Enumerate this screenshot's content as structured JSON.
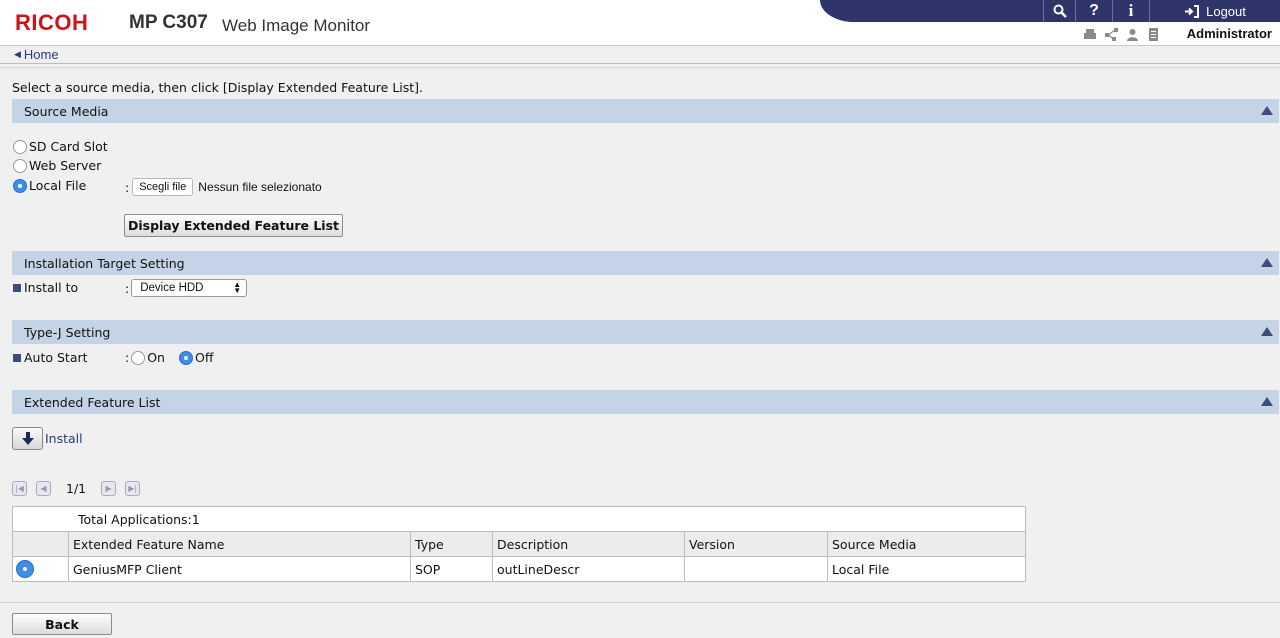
{
  "header": {
    "brand": "RICOH",
    "model": "MP C307",
    "product": "Web Image Monitor",
    "logout_label": "Logout",
    "user": "Administrator",
    "toolbar_icons": [
      "search-icon",
      "help-icon",
      "info-icon",
      "logout-icon"
    ],
    "status_icons": [
      "printer-status-icon",
      "network-icon",
      "user-icon",
      "document-icon"
    ],
    "bar_color": "#2f3569"
  },
  "breadcrumb": {
    "home": "Home"
  },
  "intro": "Select a source media, then click [Display Extended Feature List].",
  "source_media": {
    "title": "Source Media",
    "options": [
      {
        "label": "SD Card Slot",
        "selected": false
      },
      {
        "label": "Web Server",
        "selected": false
      },
      {
        "label": "Local File",
        "selected": true
      }
    ],
    "separator": ":",
    "file_button": "Scegli file",
    "file_status": "Nessun file selezionato",
    "display_button": "Display Extended Feature List"
  },
  "installation": {
    "title": "Installation Target Setting",
    "install_to_label": "Install to",
    "separator": ":",
    "install_to_value": "Device HDD"
  },
  "typej": {
    "title": "Type-J Setting",
    "auto_start_label": "Auto Start",
    "separator": ":",
    "on_label": "On",
    "off_label": "Off",
    "selected": "Off"
  },
  "feature_list": {
    "title": "Extended Feature List",
    "install_label": "Install",
    "page_indicator": "1/1",
    "total_label": "Total Applications:",
    "total_value": "1",
    "columns": [
      "Extended Feature Name",
      "Type",
      "Description",
      "Version",
      "Source Media"
    ],
    "rows": [
      {
        "name": "GeniusMFP Client",
        "type": "SOP",
        "description": "outLineDescr",
        "version": "",
        "source": "Local File",
        "selected": true
      }
    ]
  },
  "footer": {
    "back_label": "Back"
  },
  "colors": {
    "section_bar": "#c5d3e6",
    "accent": "#3b8fe8",
    "brand_red": "#d0121b"
  }
}
